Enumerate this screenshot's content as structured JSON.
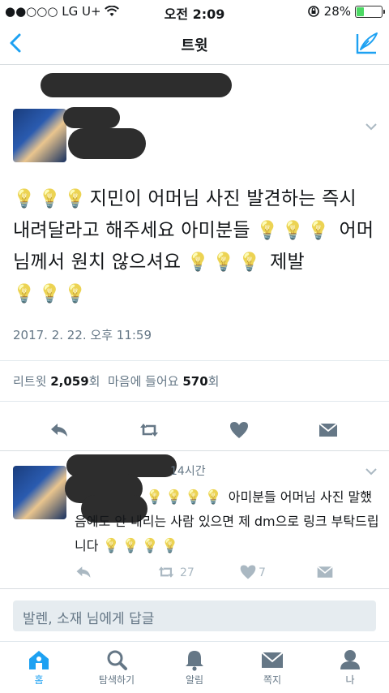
{
  "status_bar": {
    "carrier": "●●○○○ LG U+",
    "time": "오전 2:09",
    "battery": "28%",
    "battery_level": 0.28
  },
  "nav": {
    "title": "트윗"
  },
  "main_tweet": {
    "text_segments": [
      "지민이 어머님 사진 발견하는 즉시 내려달라고 해주세요 아미분들",
      "어머님께서 원치 않으셔요",
      "제발"
    ],
    "timestamp": "2017. 2. 22. 오후 11:59",
    "retweet_label": "리트윗",
    "retweet_count": "2,059",
    "count_unit": "회",
    "like_label": "마음에 들어요",
    "like_count": "570"
  },
  "reply_tweet": {
    "time_ago": "14시간",
    "text_a": "아미분들 어머님 사진",
    "text_b": "말했음에도 안 내리는 사람 있으면 제 dm으로 링크 부탁드립니다",
    "retweet_count": "27",
    "like_count": "7"
  },
  "reply_box": {
    "placeholder": "발렌, 소재 님에게 답글"
  },
  "tabs": [
    {
      "label": "홈",
      "icon": "home-icon"
    },
    {
      "label": "탐색하기",
      "icon": "search-icon"
    },
    {
      "label": "알림",
      "icon": "bell-icon"
    },
    {
      "label": "쪽지",
      "icon": "mail-icon"
    },
    {
      "label": "나",
      "icon": "profile-icon"
    }
  ],
  "colors": {
    "accent": "#1da1f2",
    "icon_gray": "#657786",
    "battery_green": "#4cd964"
  }
}
